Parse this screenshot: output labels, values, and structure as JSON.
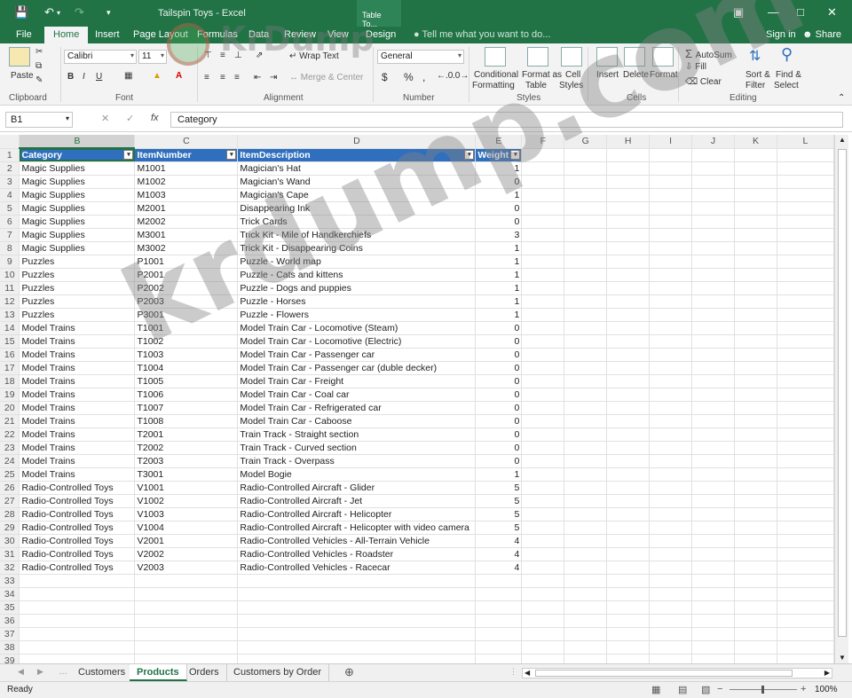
{
  "window": {
    "title": "Tailspin Toys - Excel",
    "context_tab": "Table To...",
    "minimize_icon": "minimize-icon",
    "maximize_icon": "maximize-icon",
    "close_icon": "close-icon"
  },
  "ribbon_tabs": [
    "File",
    "Home",
    "Insert",
    "Page Layout",
    "Formulas",
    "Data",
    "Review",
    "View",
    "Design"
  ],
  "active_tab": "Home",
  "tell_me": "Tell me what you want to do...",
  "account": {
    "signin": "Sign in",
    "share": "Share"
  },
  "ribbon": {
    "clipboard": {
      "paste": "Paste",
      "label": "Clipboard"
    },
    "font": {
      "name": "Calibri",
      "size": "11",
      "bold": "B",
      "italic": "I",
      "underline": "U",
      "label": "Font"
    },
    "alignment": {
      "wrap": "Wrap Text",
      "merge": "Merge & Center",
      "label": "Alignment"
    },
    "number": {
      "format": "General",
      "currency": "$",
      "percent": "%",
      "comma": ",",
      "label": "Number"
    },
    "styles": {
      "conditional": [
        "Conditional",
        "Formatting"
      ],
      "format_table": [
        "Format as",
        "Table"
      ],
      "cell_styles": [
        "Cell",
        "Styles"
      ],
      "label": "Styles"
    },
    "cells": {
      "insert": "Insert",
      "delete": "Delete",
      "format": "Format",
      "label": "Cells"
    },
    "editing": {
      "autosum": "AutoSum",
      "fill": "Fill",
      "clear": "Clear",
      "sort": [
        "Sort &",
        "Filter"
      ],
      "find": [
        "Find &",
        "Select"
      ],
      "label": "Editing"
    }
  },
  "formula_bar": {
    "name_box": "B1",
    "fx": "fx",
    "value": "Category"
  },
  "columns": [
    "B",
    "C",
    "D",
    "E",
    "F",
    "G",
    "H",
    "I",
    "J",
    "K",
    "L"
  ],
  "selected_column": "B",
  "table_headers": [
    "Category",
    "ItemNumber",
    "ItemDescription",
    "Weight"
  ],
  "rows": [
    [
      "Magic Supplies",
      "M1001",
      "Magician's Hat",
      "1"
    ],
    [
      "Magic Supplies",
      "M1002",
      "Magician's Wand",
      "0"
    ],
    [
      "Magic Supplies",
      "M1003",
      "Magician's Cape",
      "1"
    ],
    [
      "Magic Supplies",
      "M2001",
      "Disappearing Ink",
      "0"
    ],
    [
      "Magic Supplies",
      "M2002",
      "Trick Cards",
      "0"
    ],
    [
      "Magic Supplies",
      "M3001",
      "Trick Kit - Mile of Handkerchiefs",
      "3"
    ],
    [
      "Magic Supplies",
      "M3002",
      "Trick Kit - Disappearing Coins",
      "1"
    ],
    [
      "Puzzles",
      "P1001",
      "Puzzle - World map",
      "1"
    ],
    [
      "Puzzles",
      "P2001",
      "Puzzle - Cats and kittens",
      "1"
    ],
    [
      "Puzzles",
      "P2002",
      "Puzzle - Dogs and puppies",
      "1"
    ],
    [
      "Puzzles",
      "P2003",
      "Puzzle - Horses",
      "1"
    ],
    [
      "Puzzles",
      "P3001",
      "Puzzle - Flowers",
      "1"
    ],
    [
      "Model Trains",
      "T1001",
      "Model Train Car - Locomotive (Steam)",
      "0"
    ],
    [
      "Model Trains",
      "T1002",
      "Model Train Car - Locomotive (Electric)",
      "0"
    ],
    [
      "Model Trains",
      "T1003",
      "Model Train Car - Passenger car",
      "0"
    ],
    [
      "Model Trains",
      "T1004",
      "Model Train Car - Passenger car (duble decker)",
      "0"
    ],
    [
      "Model Trains",
      "T1005",
      "Model Train Car - Freight",
      "0"
    ],
    [
      "Model Trains",
      "T1006",
      "Model Train Car - Coal car",
      "0"
    ],
    [
      "Model Trains",
      "T1007",
      "Model Train Car - Refrigerated car",
      "0"
    ],
    [
      "Model Trains",
      "T1008",
      "Model Train Car - Caboose",
      "0"
    ],
    [
      "Model Trains",
      "T2001",
      "Train Track - Straight section",
      "0"
    ],
    [
      "Model Trains",
      "T2002",
      "Train Track - Curved section",
      "0"
    ],
    [
      "Model Trains",
      "T2003",
      "Train Track - Overpass",
      "0"
    ],
    [
      "Model Trains",
      "T3001",
      "Model Bogie",
      "1"
    ],
    [
      "Radio-Controlled Toys",
      "V1001",
      "Radio-Controlled Aircraft - Glider",
      "5"
    ],
    [
      "Radio-Controlled Toys",
      "V1002",
      "Radio-Controlled Aircraft - Jet",
      "5"
    ],
    [
      "Radio-Controlled Toys",
      "V1003",
      "Radio-Controlled Aircraft - Helicopter",
      "5"
    ],
    [
      "Radio-Controlled Toys",
      "V1004",
      "Radio-Controlled Aircraft - Helicopter with video camera",
      "5"
    ],
    [
      "Radio-Controlled Toys",
      "V2001",
      "Radio-Controlled Vehicles - All-Terrain Vehicle",
      "4"
    ],
    [
      "Radio-Controlled Toys",
      "V2002",
      "Radio-Controlled Vehicles - Roadster",
      "4"
    ],
    [
      "Radio-Controlled Toys",
      "V2003",
      "Radio-Controlled Vehicles - Racecar",
      "4"
    ]
  ],
  "empty_row_numbers": [
    "33",
    "34",
    "35",
    "36",
    "37",
    "38",
    "39"
  ],
  "sheet_tabs": [
    "Customers",
    "Products",
    "Orders",
    "Customers by Order"
  ],
  "active_sheet": "Products",
  "status": {
    "ready": "Ready",
    "zoom": "100%"
  },
  "watermark": "krdump.com",
  "watermark_logo": "KrDump",
  "colors": {
    "excel_green": "#217346",
    "table_header": "#2f6fbd"
  }
}
